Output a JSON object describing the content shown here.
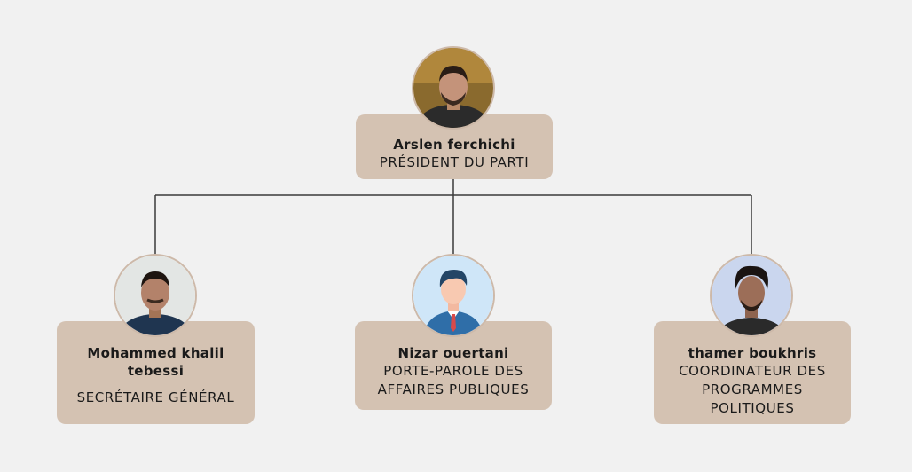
{
  "members": [
    {
      "name": "Arslen ferchichi",
      "role": "PRÉSIDENT DU PARTI"
    },
    {
      "name": "Mohammed khalil tebessi",
      "role": "SECRÉTAIRE GÉNÉRAL"
    },
    {
      "name": "Nizar ouertani",
      "role": "PORTE-PAROLE DES AFFAIRES PUBLIQUES"
    },
    {
      "name": "thamer boukhris",
      "role": "COORDINATEUR DES PROGRAMMES POLITIQUES"
    }
  ],
  "colors": {
    "card": "#d4c2b2",
    "background": "#f1f1f1",
    "line": "#3a3a3a"
  }
}
